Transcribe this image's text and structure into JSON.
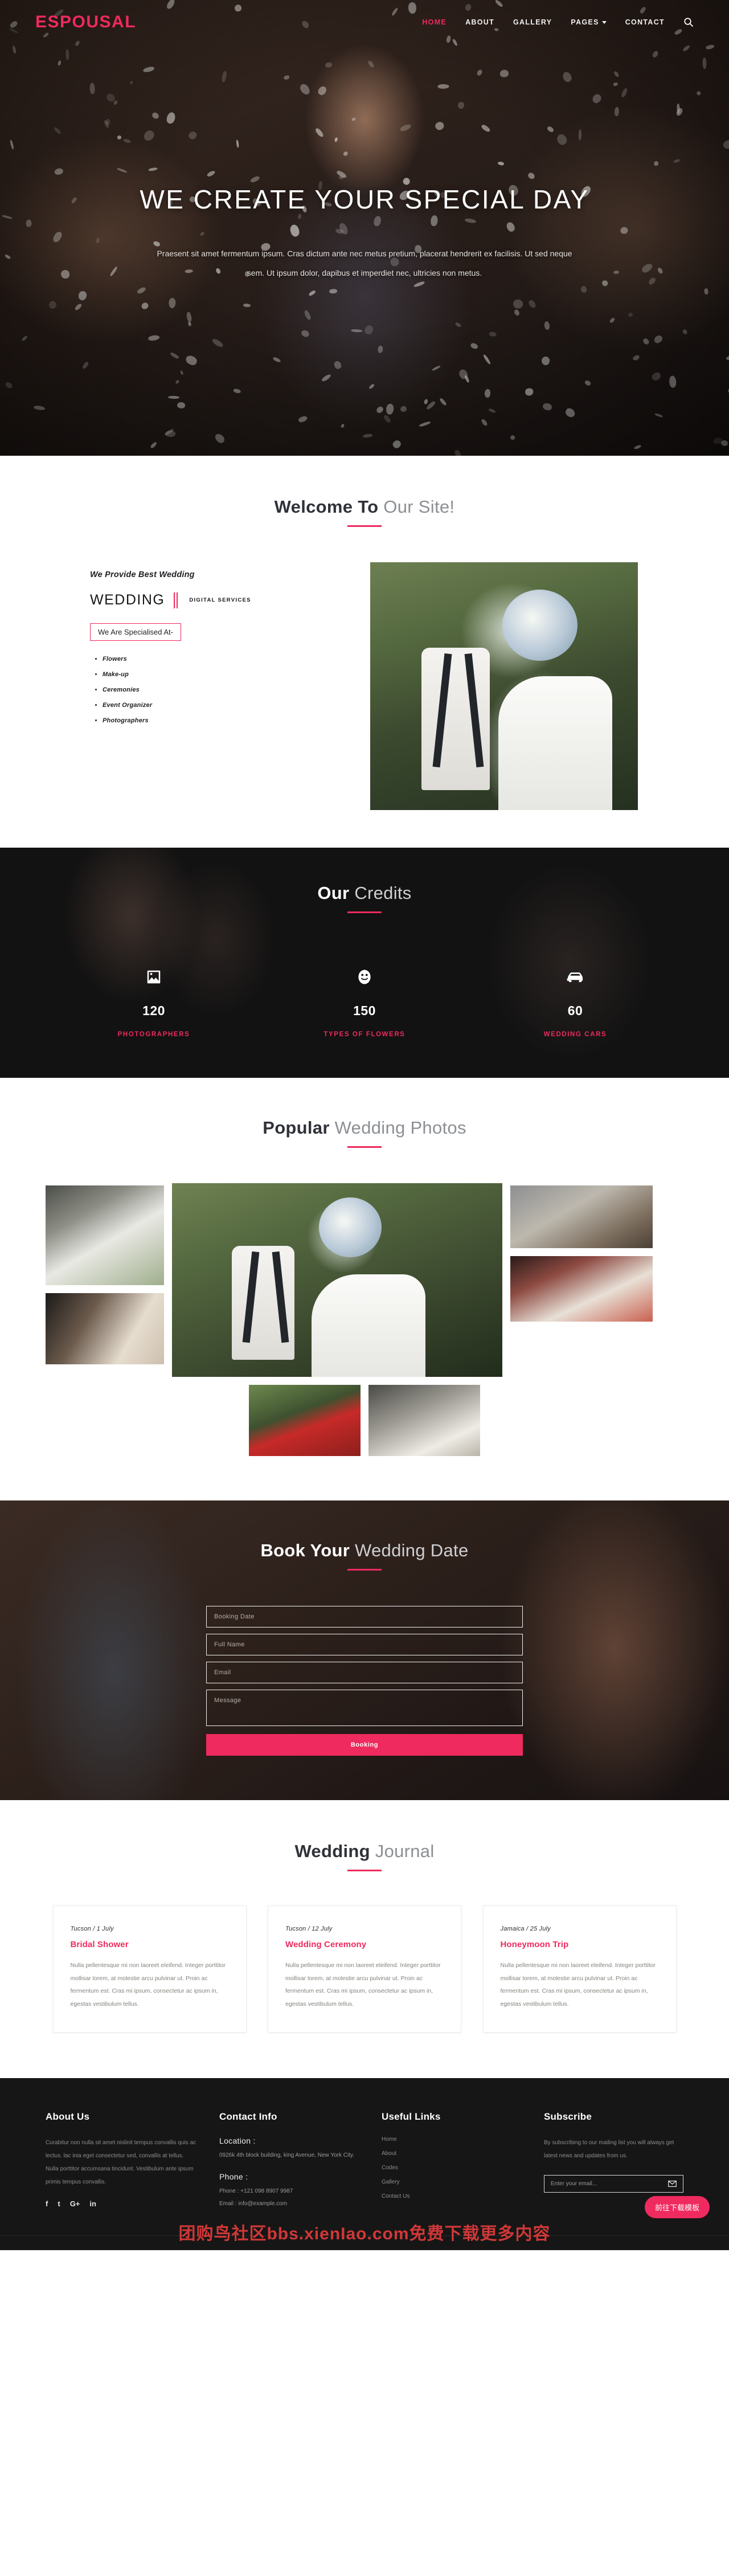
{
  "nav": {
    "logo": "ESPOUSAL",
    "items": [
      {
        "label": "HOME",
        "active": true
      },
      {
        "label": "ABOUT",
        "active": false
      },
      {
        "label": "GALLERY",
        "active": false
      },
      {
        "label": "PAGES",
        "active": false,
        "dropdown": true
      },
      {
        "label": "CONTACT",
        "active": false
      }
    ],
    "search_icon": "search-icon"
  },
  "hero": {
    "title": "WE CREATE YOUR SPECIAL DAY",
    "subtitle": "Praesent sit amet fermentum ipsum. Cras dictum ante nec metus pretium, placerat hendrerit ex facilisis. Ut sed neque sem. Ut ipsum dolor, dapibus et imperdiet nec, ultricies non metus."
  },
  "welcome": {
    "heading_bold": "Welcome To",
    "heading_light": "Our Site!",
    "tagline": "We Provide Best Wedding",
    "brand_main": "WEDDING",
    "brand_sub": "DIGITAL SERVICES",
    "specialised_label": "We Are Specialised At-",
    "services": [
      "Flowers",
      "Make-up",
      "Ceremonies",
      "Event Organizer",
      "Photographers"
    ]
  },
  "credits": {
    "heading_bold": "Our",
    "heading_light": "Credits",
    "items": [
      {
        "icon": "image-icon",
        "value": "120",
        "label": "PHOTOGRAPHERS"
      },
      {
        "icon": "smiley-icon",
        "value": "150",
        "label": "TYPES OF FLOWERS"
      },
      {
        "icon": "car-icon",
        "value": "60",
        "label": "WEDDING CARS"
      }
    ]
  },
  "gallery": {
    "heading_bold": "Popular",
    "heading_light": "Wedding Photos",
    "photos": [
      {
        "name": "bride-groom-veil-photo"
      },
      {
        "name": "ring-exchange-photo"
      },
      {
        "name": "couple-bouquet-main-photo"
      },
      {
        "name": "couple-walking-beach-photo"
      },
      {
        "name": "table-flowers-decor-photo"
      },
      {
        "name": "bride-red-car-photo"
      },
      {
        "name": "bride-stone-wall-photo"
      }
    ]
  },
  "booking": {
    "heading_bold": "Book Your",
    "heading_light": "Wedding Date",
    "fields": [
      {
        "name": "booking-date",
        "placeholder": "Booking Date",
        "value": ""
      },
      {
        "name": "full-name",
        "placeholder": "Full Name",
        "value": ""
      },
      {
        "name": "email",
        "placeholder": "Email",
        "value": ""
      },
      {
        "name": "message",
        "placeholder": "Message",
        "value": ""
      }
    ],
    "submit_label": "Booking"
  },
  "journal": {
    "heading_bold": "Wedding",
    "heading_light": "Journal",
    "cards": [
      {
        "meta": "Tucson / 1 July",
        "title": "Bridal Shower",
        "text": "Nulla pellentesque mi non laoreet eleifend. Integer porttitor mollisar lorem, at molestie arcu pulvinar ut. Proin ac fermentum est. Cras mi ipsum, consectetur ac ipsum in, egestas vestibulum tellus."
      },
      {
        "meta": "Tucson / 12 July",
        "title": "Wedding Ceremony",
        "text": "Nulla pellentesque mi non laoreet eleifend. Integer porttitor mollisar lorem, at molestie arcu pulvinar ut. Proin ac fermentum est. Cras mi ipsum, consectetur ac ipsum in, egestas vestibulum tellus."
      },
      {
        "meta": "Jamaica / 25 July",
        "title": "Honeymoon Trip",
        "text": "Nulla pellentesque mi non laoreet eleifend. Integer porttitor mollisar lorem, at molestie arcu pulvinar ut. Proin ac fermentum est. Cras mi ipsum, consectetur ac ipsum in, egestas vestibulum tellus."
      }
    ]
  },
  "footer": {
    "about": {
      "heading": "About Us",
      "text": "Curabitur non nulla sit amet nislinit tempus convallis quis ac lectus. lac inia eget consectetur sed, convallis at tellus. Nulla porttitor accumsana tincidunt. Vestibulum ante ipsum primis tempus convallis.",
      "socials": [
        "facebook-icon",
        "twitter-icon",
        "google-plus-icon",
        "linkedin-icon"
      ],
      "social_glyphs": [
        "f",
        "t",
        "G+",
        "in"
      ]
    },
    "contact": {
      "heading": "Contact Info",
      "location_label": "Location :",
      "location_value": "0926k 4th block building, king Avenue, New York City.",
      "phone_label": "Phone :",
      "phone_value": "Phone : +121 098 8907 9987",
      "email_value": "Email : info@example.com"
    },
    "links": {
      "heading": "Useful Links",
      "items": [
        "Home",
        "About",
        "Codes",
        "Gallery",
        "Contact Us"
      ]
    },
    "subscribe": {
      "heading": "Subscribe",
      "text": "By subscribing to our mailing list you will always get latest news and updates from us.",
      "placeholder": "Enter your email...",
      "value": "",
      "icon": "envelope-icon"
    }
  },
  "overlays": {
    "watermark": "团购鸟社区bbs.xienIao.com免费下载更多内容",
    "float_button": "前往下载模板"
  },
  "colors": {
    "accent": "#ef2a5e",
    "dark": "#161616",
    "heading_dark": "#2f3238",
    "heading_light": "#8c8f93"
  }
}
